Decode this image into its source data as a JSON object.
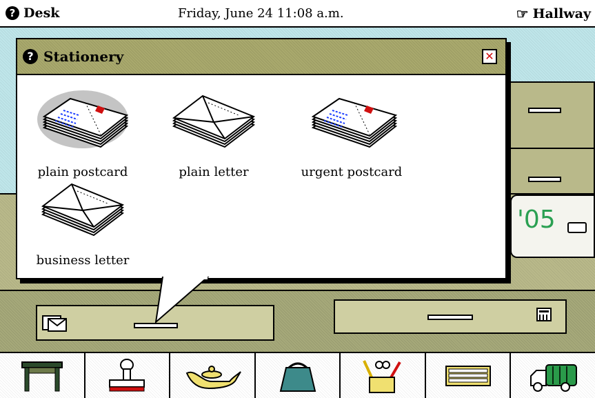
{
  "topbar": {
    "left_label": "Desk",
    "datetime": "Friday, June 24  11:08 a.m.",
    "right_label": "Hallway"
  },
  "popup": {
    "title": "Stationery",
    "items": [
      {
        "label": "plain postcard",
        "icon": "postcard-stack-icon",
        "selected": true
      },
      {
        "label": "plain letter",
        "icon": "envelope-stack-icon",
        "selected": false
      },
      {
        "label": "urgent postcard",
        "icon": "postcard-stack-icon",
        "selected": false
      },
      {
        "label": "business letter",
        "icon": "envelope-stack-icon",
        "selected": false
      }
    ]
  },
  "planner": {
    "year_text": "'05"
  },
  "toolbar": {
    "tools": [
      {
        "name": "desk-tool",
        "icon": "desk-icon"
      },
      {
        "name": "stamp-tool",
        "icon": "stamp-icon"
      },
      {
        "name": "lamp-tool",
        "icon": "magic-lamp-icon"
      },
      {
        "name": "bag-tool",
        "icon": "bag-icon"
      },
      {
        "name": "office-supplies-tool",
        "icon": "pencil-cup-icon"
      },
      {
        "name": "keyboard-tool",
        "icon": "keyboard-icon"
      },
      {
        "name": "trash-truck-tool",
        "icon": "garbage-truck-icon"
      }
    ]
  },
  "colors": {
    "olive": "#a9a96d",
    "cyan": "#bfe6ea",
    "planner_green": "#2aa052",
    "close_red": "#d01010",
    "stamp_red": "#d01010"
  }
}
